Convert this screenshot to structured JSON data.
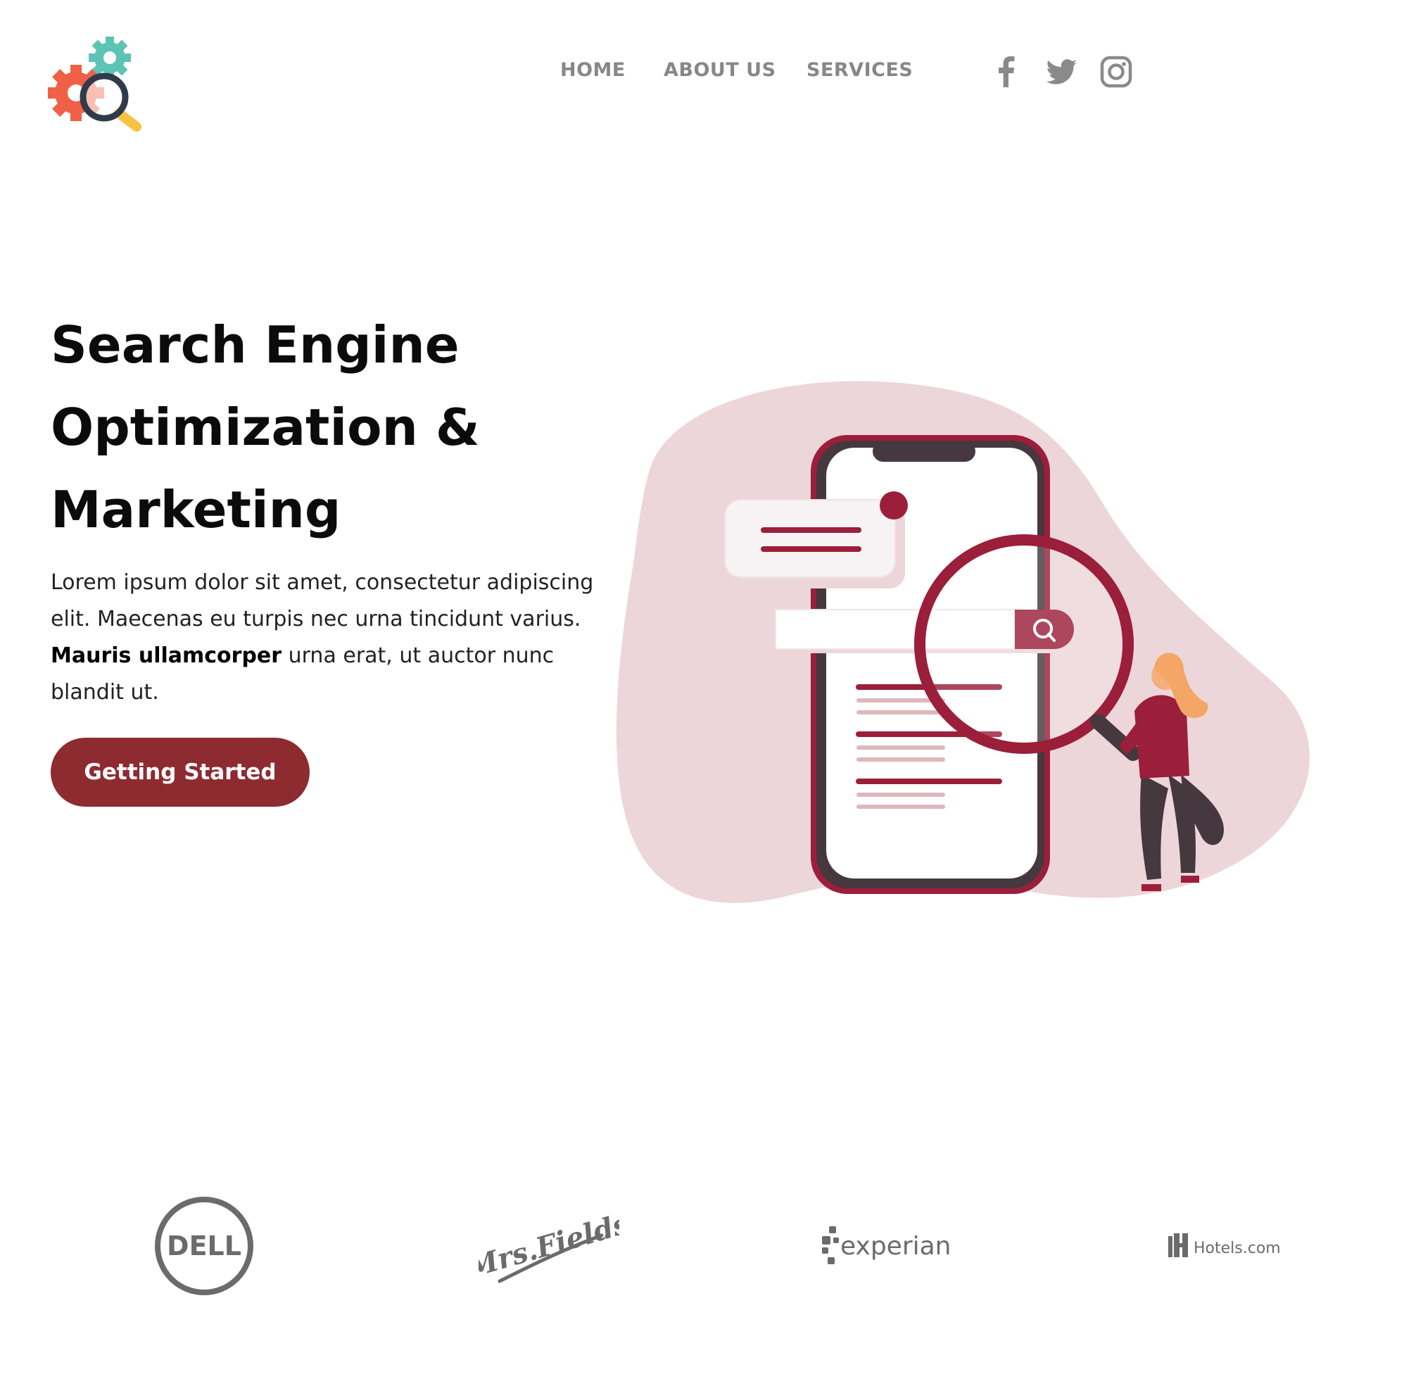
{
  "header": {
    "logo_icon": "gears-magnifier-logo",
    "nav": [
      {
        "label": "HOME"
      },
      {
        "label": "ABOUT US"
      },
      {
        "label": "SERVICES"
      }
    ],
    "social": [
      {
        "icon": "facebook-icon"
      },
      {
        "icon": "twitter-icon"
      },
      {
        "icon": "instagram-icon"
      }
    ]
  },
  "hero": {
    "title_lines": [
      "Search Engine",
      "Optimization &",
      "Marketing"
    ],
    "text_before_bold": "Lorem ipsum dolor sit amet, consectetur adipiscing elit. Maecenas eu turpis nec urna tincidunt varius. ",
    "text_bold": "Mauris ullamcorper",
    "text_after_bold": " urna erat, ut auctor nunc blandit ut.",
    "cta_label": "Getting Started",
    "illustration": "seo-search-illustration"
  },
  "brands": [
    {
      "name": "DELL"
    },
    {
      "name": "Mrs.Fields"
    },
    {
      "name": "experian"
    },
    {
      "name": "Hotels.com"
    }
  ],
  "colors": {
    "accent": "#8e2b30",
    "illustration_red": "#9b1f3a",
    "blob": "#ecd6da",
    "nav_gray": "#878787",
    "brand_gray": "#6b6b6b"
  }
}
